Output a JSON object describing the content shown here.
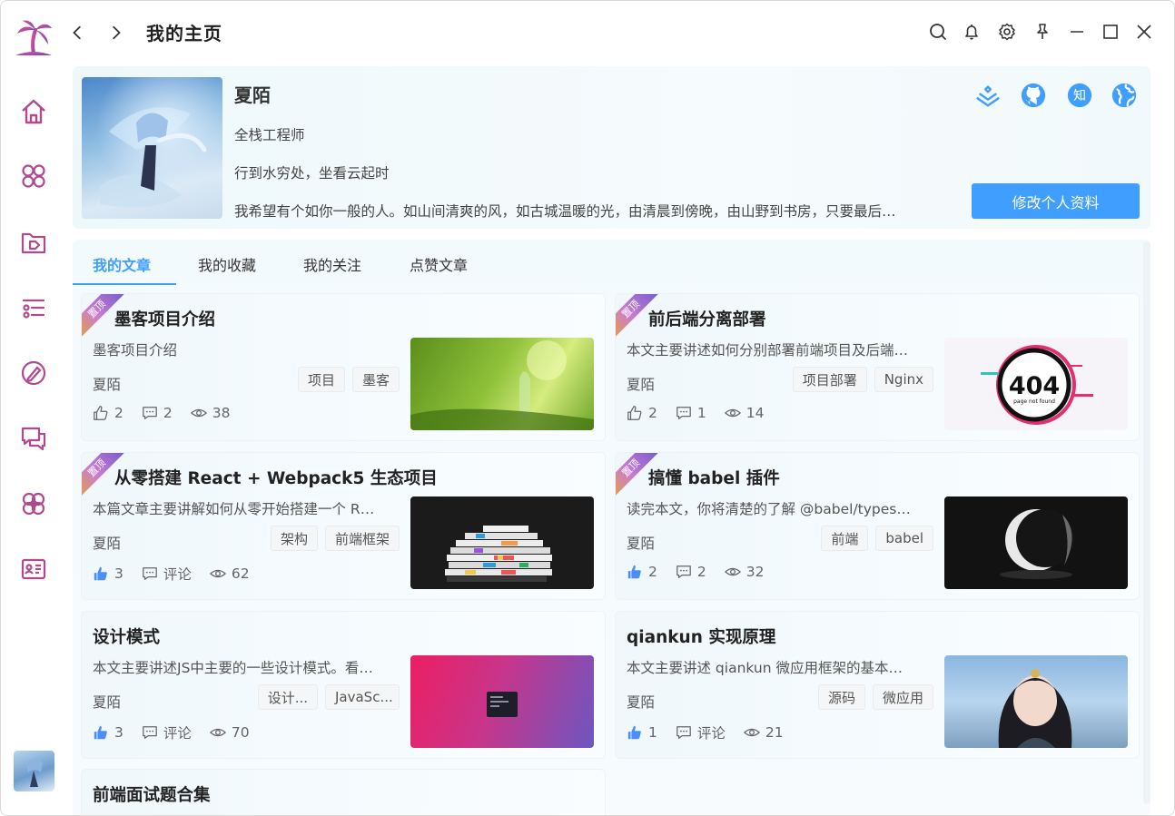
{
  "header": {
    "title": "我的主页"
  },
  "sidebar": {
    "items": [
      {
        "name": "home-icon"
      },
      {
        "name": "apps-icon"
      },
      {
        "name": "tag-folder-icon"
      },
      {
        "name": "list-settings-icon"
      },
      {
        "name": "edit-pen-icon"
      },
      {
        "name": "chat-icon"
      },
      {
        "name": "plugin-icon"
      },
      {
        "name": "profile-card-icon"
      }
    ]
  },
  "profile": {
    "name": "夏陌",
    "title": "全栈工程师",
    "motto": "行到水穷处，坐看云起时",
    "bio": "我希望有个如你一般的人。如山间清爽的风，如古城温暖的光，由清晨到傍晚，由山野到书房，只要最后…",
    "edit_label": "修改个人资料",
    "links": [
      "juejin-icon",
      "github-icon",
      "zhihu-icon",
      "website-icon"
    ],
    "zhihu_text": "知"
  },
  "tabs": [
    "我的文章",
    "我的收藏",
    "我的关注",
    "点赞文章"
  ],
  "articles": [
    {
      "pinned": true,
      "pin_label": "置顶",
      "title": "墨客项目介绍",
      "summary": "墨客项目介绍",
      "author": "夏陌",
      "tags": [
        "项目",
        "墨客"
      ],
      "likes": "2",
      "comments": "2",
      "views": "38",
      "liked": false
    },
    {
      "pinned": true,
      "pin_label": "置顶",
      "title": "前后端分离部署",
      "summary": "本文主要讲述如何分别部署前端项目及后端…",
      "author": "夏陌",
      "tags": [
        "项目部署",
        "Nginx"
      ],
      "likes": "2",
      "comments": "1",
      "views": "14",
      "liked": false,
      "cover_text": "404",
      "cover_subtext": "page not found"
    },
    {
      "pinned": true,
      "pin_label": "置顶",
      "title": "从零搭建 React + Webpack5 生态项目",
      "summary": "本篇文章主要讲解如何从零开始搭建一个 R…",
      "author": "夏陌",
      "tags": [
        "架构",
        "前端框架"
      ],
      "likes": "3",
      "comments": "评论",
      "views": "62",
      "liked": true
    },
    {
      "pinned": true,
      "pin_label": "置顶",
      "title": "搞懂 babel 插件",
      "summary": "读完本文，你将清楚的了解 @babel/types…",
      "author": "夏陌",
      "tags": [
        "前端",
        "babel"
      ],
      "likes": "2",
      "comments": "2",
      "views": "32",
      "liked": true
    },
    {
      "pinned": false,
      "title": "设计模式",
      "summary": "本文主要讲述JS中主要的一些设计模式。看…",
      "author": "夏陌",
      "tags": [
        "设计...",
        "JavaSc..."
      ],
      "likes": "3",
      "comments": "评论",
      "views": "70",
      "liked": true
    },
    {
      "pinned": false,
      "title": "qiankun 实现原理",
      "summary": "本文主要讲述 qiankun 微应用框架的基本…",
      "author": "夏陌",
      "tags": [
        "源码",
        "微应用"
      ],
      "likes": "1",
      "comments": "评论",
      "views": "21",
      "liked": true
    }
  ],
  "partial_article": {
    "title": "前端面试题合集"
  },
  "colors": {
    "accent": "#409eff",
    "sidebar_icon": "#b04a8c"
  }
}
